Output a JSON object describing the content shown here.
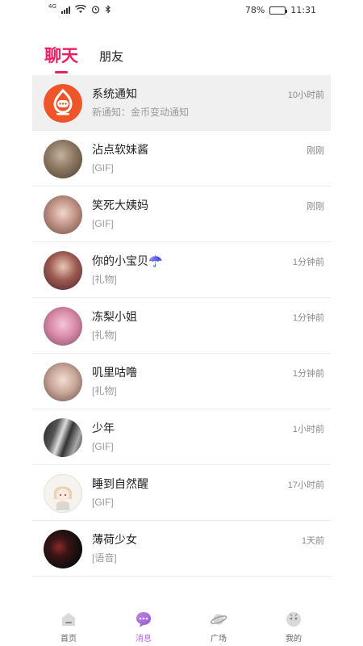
{
  "status_bar": {
    "signal_label": "4G",
    "battery": "78%",
    "time": "11:31"
  },
  "tabs": [
    {
      "label": "聊天",
      "active": true
    },
    {
      "label": "朋友",
      "active": false
    }
  ],
  "conversations": [
    {
      "name": "系统通知",
      "preview": "新通知：金币变动通知",
      "time": "10小时前",
      "avatar": "system-notification-icon",
      "highlighted": true
    },
    {
      "name": "沾点软妹酱",
      "preview": "[GIF]",
      "time": "刚刚",
      "avatar": "user-photo"
    },
    {
      "name": "笑死大姨妈",
      "preview": "[GIF]",
      "time": "刚刚",
      "avatar": "user-photo"
    },
    {
      "name": "你的小宝贝☂️",
      "preview": "[礼物]",
      "time": "1分钟前",
      "avatar": "user-photo"
    },
    {
      "name": "冻梨小姐",
      "preview": "[礼物]",
      "time": "1分钟前",
      "avatar": "user-photo"
    },
    {
      "name": "叽里咕噜",
      "preview": "[礼物]",
      "time": "1分钟前",
      "avatar": "user-photo"
    },
    {
      "name": "少年",
      "preview": "[GIF]",
      "time": "1小时前",
      "avatar": "user-photo"
    },
    {
      "name": "睡到自然醒",
      "preview": "[GIF]",
      "time": "17小时前",
      "avatar": "user-illustration"
    },
    {
      "name": "薄荷少女",
      "preview": "[语音]",
      "time": "1天前",
      "avatar": "user-photo"
    }
  ],
  "bottom_nav": [
    {
      "label": "首页",
      "icon": "home-icon",
      "active": false
    },
    {
      "label": "消息",
      "icon": "message-icon",
      "active": true
    },
    {
      "label": "广场",
      "icon": "planet-icon",
      "active": false
    },
    {
      "label": "我的",
      "icon": "profile-icon",
      "active": false
    }
  ],
  "colors": {
    "accent": "#e91e63",
    "nav_active": "#b16ad9",
    "system_avatar": "#f0552a"
  }
}
